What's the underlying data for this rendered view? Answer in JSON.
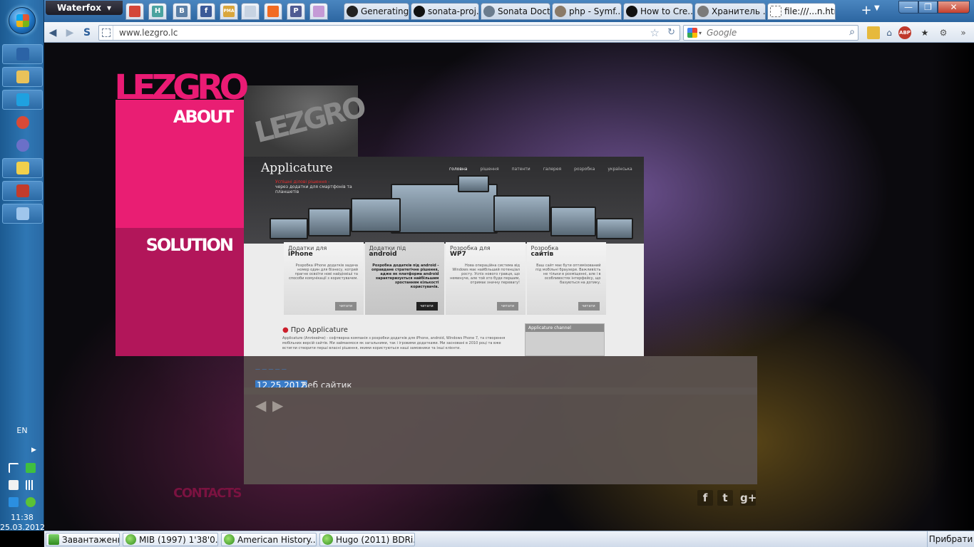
{
  "os": {
    "left_taskbar": {
      "pinned": [
        {
          "name": "network-icon",
          "color": "#2b63a6"
        },
        {
          "name": "explorer-icon",
          "color": "#e9c25a"
        },
        {
          "name": "skype-icon",
          "color": "#1fa1e0"
        },
        {
          "name": "chrome-icon",
          "color": "#d84a37"
        },
        {
          "name": "app-icon",
          "color": "#6b70c8"
        },
        {
          "name": "messenger-icon",
          "color": "#f1d04c"
        },
        {
          "name": "bug-icon",
          "color": "#c23b2b"
        },
        {
          "name": "window-icon",
          "color": "#9fc6ec"
        }
      ],
      "language": "EN",
      "clock_time": "11:38",
      "clock_date": "25.03.2012"
    },
    "bottom_taskbar": {
      "items": [
        {
          "label": "Завантаження"
        },
        {
          "label": "MIB (1997) 1'38'0..."
        },
        {
          "label": "American History..."
        },
        {
          "label": "Hugo (2011) BDRi..."
        }
      ],
      "hide_label": "Прибрати"
    }
  },
  "browser": {
    "app_menu_label": "Waterfox",
    "app_tabs": [
      {
        "name": "gmail-tab-icon",
        "glyph": "",
        "color": "#d44638"
      },
      {
        "name": "h-tab-icon",
        "glyph": "H",
        "color": "#4aa3a0"
      },
      {
        "name": "vk-tab-icon",
        "glyph": "B",
        "color": "#5b7fa6"
      },
      {
        "name": "facebook-tab-icon",
        "glyph": "f",
        "color": "#3b5998"
      },
      {
        "name": "phpmyadmin-tab-icon",
        "glyph": "PMA",
        "color": "#d9a63c"
      },
      {
        "name": "blank-tab-icon",
        "glyph": "",
        "color": "#c7d3e2"
      },
      {
        "name": "xampp-tab-icon",
        "glyph": "",
        "color": "#f26b21"
      },
      {
        "name": "php-tab-icon",
        "glyph": "P",
        "color": "#4f5b93"
      },
      {
        "name": "purple-tab-icon",
        "glyph": "",
        "color": "#c59ad6"
      }
    ],
    "tabs": [
      {
        "label": "Generating ...",
        "color": "#222222"
      },
      {
        "label": "sonata-proj...",
        "color": "#111111"
      },
      {
        "label": "Sonata Doct...",
        "color": "#6b7c8e"
      },
      {
        "label": "php - Symf...",
        "color": "#8a7a68"
      },
      {
        "label": "How to Cre...",
        "color": "#111111"
      },
      {
        "label": "Хранитель ...",
        "color": "#7a7a7a"
      },
      {
        "label": "file:///...n.html",
        "color": "#ffffff",
        "active": true
      }
    ],
    "url": "www.lezgro.lc",
    "search_placeholder": "Google"
  },
  "site": {
    "logo": "LEZGRO",
    "nav": {
      "about": "ABOUT",
      "solution": "SOLUTION",
      "contacts": "CONTACTS"
    },
    "hero_bg_text": "LEZGRO",
    "colors": {
      "pink": "#e91e73",
      "dark_pink": "#b2165a",
      "panel": "#5c5450"
    },
    "portfolio_preview": {
      "logo": "Applicature",
      "nav": [
        "головна",
        "рішення",
        "патенти",
        "галерея",
        "розробка",
        "українська"
      ],
      "tagline_highlight": "Успішні ділові рішення -",
      "tagline_rest": "через додатки для смартфонів та планшетів",
      "cards": [
        {
          "title": "Додатки для",
          "title_bold": "iPhone",
          "text": "Розробка iPhone додатків задача номер один для бізнесу, котрий прагне освоїти нові найдієвіші та способи комунікації з користувачем.",
          "more": "читати"
        },
        {
          "title": "Додатки під",
          "title_bold": "android",
          "text": "Розробка додатків під android - оправдане стратегічне рішення, адже як платформа android характеризується найбільшим зростанням кількості користувачів.",
          "more": "читати"
        },
        {
          "title": "Розробка для",
          "title_bold": "WP7",
          "text": "Нова операційна система від Windows має найбільший потенціал росту. Успіх нового гравця, що неминуче, але той хто буде першим, отримає значну перевагу!",
          "more": "читати"
        },
        {
          "title": "Розробка",
          "title_bold": "сайтів",
          "text": "Ваш сайт має бути оптимізований під мобільні браузери. Важливість не тільки в розміщенні, але і в особливостях інтерфейсу, що базуються на дотику.",
          "more": "читати"
        }
      ],
      "about_title": "Про Applicature",
      "about_text": "Applicature (Аплікейче) - софтверна компанія з розробки додатків для iPhone, android, Windows Phone 7, та створення мобільних версій сайтів. Ми займаємося як загальними, так і ігровими додатками. Ми засновані в 2010 році та вже встигли створити перші власні рішення, якими користуються наші замовники та інші клієнти.",
      "channel_title": "Applicature channel"
    },
    "project": {
      "deco": "— — — — —",
      "date": "12.25.2012",
      "title": "Веб сайтик"
    },
    "social": [
      {
        "name": "facebook-icon",
        "glyph": "f"
      },
      {
        "name": "twitter-icon",
        "glyph": "t"
      },
      {
        "name": "google-plus-icon",
        "glyph": "g+"
      }
    ]
  }
}
